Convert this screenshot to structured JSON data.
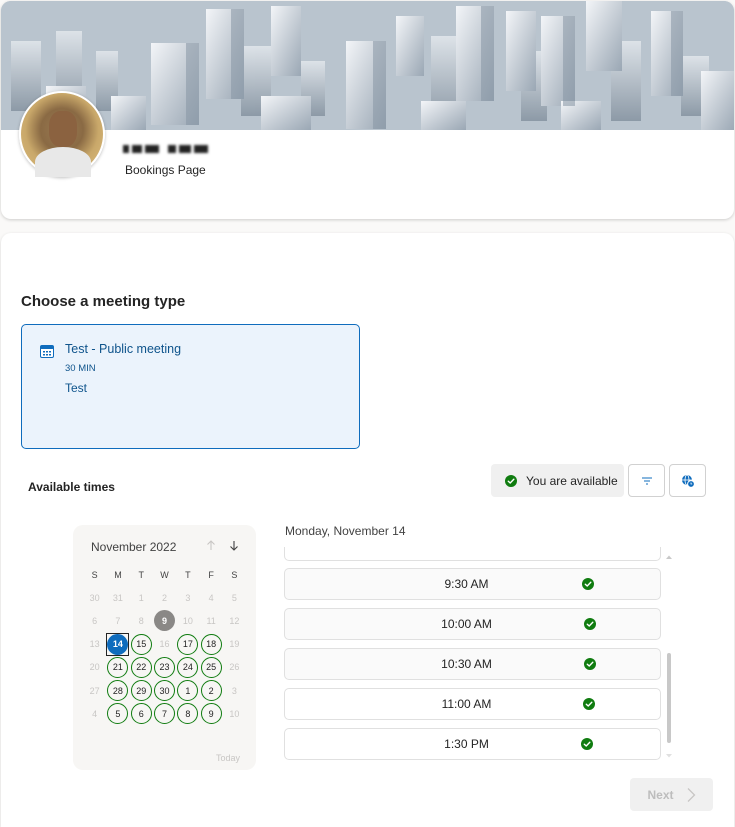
{
  "header": {
    "page_label": "Bookings Page"
  },
  "main": {
    "section_title": "Choose a meeting type",
    "meeting": {
      "title": "Test - Public meeting",
      "duration": "30 MIN",
      "description": "Test",
      "icon": "calendar-icon"
    },
    "available_label": "Available times",
    "availability_status": "You are available",
    "status_color": "#107c10",
    "accent_color": "#0f6cbd"
  },
  "calendar": {
    "month_label": "November 2022",
    "weekdays": [
      "S",
      "M",
      "T",
      "W",
      "T",
      "F",
      "S"
    ],
    "today_link": "Today",
    "days": [
      {
        "n": "30",
        "state": "dim"
      },
      {
        "n": "31",
        "state": "dim"
      },
      {
        "n": "1",
        "state": "dim"
      },
      {
        "n": "2",
        "state": "dim"
      },
      {
        "n": "3",
        "state": "dim"
      },
      {
        "n": "4",
        "state": "dim"
      },
      {
        "n": "5",
        "state": "dim"
      },
      {
        "n": "6",
        "state": "dim"
      },
      {
        "n": "7",
        "state": "dim"
      },
      {
        "n": "8",
        "state": "dim"
      },
      {
        "n": "9",
        "state": "today"
      },
      {
        "n": "10",
        "state": "dim"
      },
      {
        "n": "11",
        "state": "dim"
      },
      {
        "n": "12",
        "state": "dim"
      },
      {
        "n": "13",
        "state": "dim"
      },
      {
        "n": "14",
        "state": "selected"
      },
      {
        "n": "15",
        "state": "avail"
      },
      {
        "n": "16",
        "state": "dim"
      },
      {
        "n": "17",
        "state": "avail"
      },
      {
        "n": "18",
        "state": "avail"
      },
      {
        "n": "19",
        "state": "dim"
      },
      {
        "n": "20",
        "state": "dim"
      },
      {
        "n": "21",
        "state": "avail"
      },
      {
        "n": "22",
        "state": "avail"
      },
      {
        "n": "23",
        "state": "avail"
      },
      {
        "n": "24",
        "state": "avail"
      },
      {
        "n": "25",
        "state": "avail"
      },
      {
        "n": "26",
        "state": "dim"
      },
      {
        "n": "27",
        "state": "dim"
      },
      {
        "n": "28",
        "state": "avail"
      },
      {
        "n": "29",
        "state": "avail"
      },
      {
        "n": "30",
        "state": "avail"
      },
      {
        "n": "1",
        "state": "avail"
      },
      {
        "n": "2",
        "state": "avail"
      },
      {
        "n": "3",
        "state": "dim"
      },
      {
        "n": "4",
        "state": "dim"
      },
      {
        "n": "5",
        "state": "avail"
      },
      {
        "n": "6",
        "state": "avail"
      },
      {
        "n": "7",
        "state": "avail"
      },
      {
        "n": "8",
        "state": "avail"
      },
      {
        "n": "9",
        "state": "avail"
      },
      {
        "n": "10",
        "state": "dim"
      }
    ]
  },
  "slots": {
    "date_heading": "Monday, November 14",
    "times": [
      "9:30 AM",
      "10:00 AM",
      "10:30 AM",
      "11:00 AM",
      "1:30 PM"
    ]
  },
  "footer": {
    "next_label": "Next"
  }
}
